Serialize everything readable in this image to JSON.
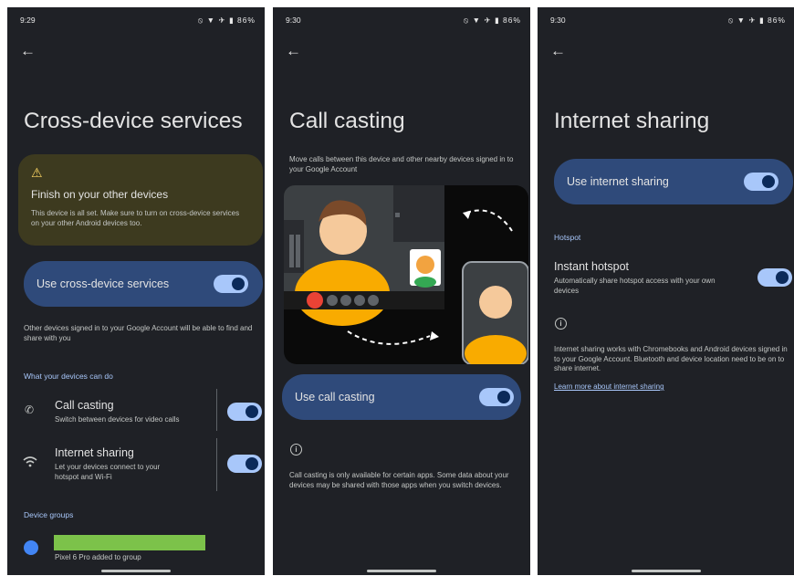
{
  "screen1": {
    "status": {
      "time": "9:29",
      "icons": "⦸ ▼ ✈ ▮ 86%"
    },
    "title": "Cross-device services",
    "warning": {
      "title": "Finish on your other devices",
      "body": "This device is all set. Make sure to turn on cross-device services on your other Android devices too."
    },
    "main_toggle": {
      "label": "Use cross-device services",
      "on": true
    },
    "description": "Other devices signed in to your Google Account will be able to find and share with you",
    "section_label": "What your devices can do",
    "features": [
      {
        "title": "Call casting",
        "subtitle": "Switch between devices for video calls",
        "on": true
      },
      {
        "title": "Internet sharing",
        "subtitle": "Let your devices connect to your hotspot and Wi-Fi",
        "on": true
      }
    ],
    "groups_label": "Device groups",
    "group_item": {
      "subtitle": "Pixel 6 Pro added to group",
      "bar_color": "#7cc24a"
    }
  },
  "screen2": {
    "status": {
      "time": "9:30",
      "icons": "⦸ ▼ ✈ ▮ 86%"
    },
    "title": "Call casting",
    "description": "Move calls between this device and other nearby devices signed in to your Google Account",
    "toggle": {
      "label": "Use call casting",
      "on": true
    },
    "info": "Call casting is only available for certain apps. Some data about your devices may be shared with those apps when you switch devices."
  },
  "screen3": {
    "status": {
      "time": "9:30",
      "icons": "⦸ ▼ ✈ ▮ 86%"
    },
    "title": "Internet sharing",
    "toggle": {
      "label": "Use internet sharing",
      "on": true
    },
    "section_label": "Hotspot",
    "hotspot": {
      "title": "Instant hotspot",
      "subtitle": "Automatically share hotspot access with your own devices",
      "on": true
    },
    "info": "Internet sharing works with Chromebooks and Android devices signed in to your Google Account. Bluetooth and device location need to be on to share internet.",
    "link": "Learn more about internet sharing"
  },
  "colors": {
    "background": "#1f2126",
    "pill": "#2f4a7a",
    "switch_track": "#a8c7fa",
    "accent": "#a8c7fa",
    "warning_bg": "#3d3a1f"
  }
}
